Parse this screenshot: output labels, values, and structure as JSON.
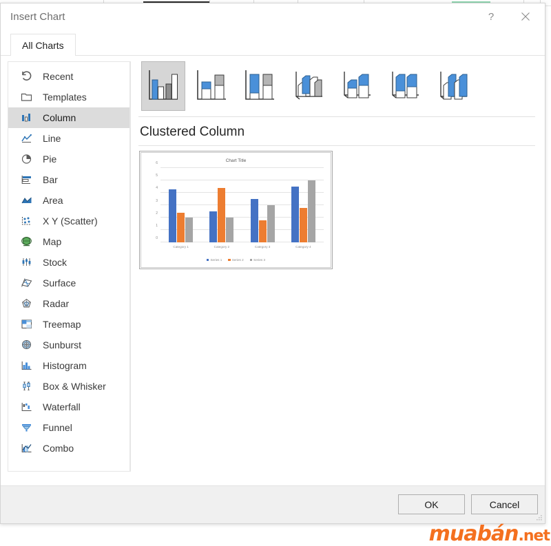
{
  "dialog": {
    "title": "Insert Chart",
    "help_label": "?",
    "close_label": "×"
  },
  "tabs": [
    {
      "label": "All Charts",
      "name": "tab-all-charts",
      "active": true
    }
  ],
  "sidebar": {
    "items": [
      {
        "label": "Recent",
        "icon": "recent-icon",
        "selected": false
      },
      {
        "label": "Templates",
        "icon": "templates-icon",
        "selected": false
      },
      {
        "label": "Column",
        "icon": "column-chart-icon",
        "selected": true
      },
      {
        "label": "Line",
        "icon": "line-chart-icon",
        "selected": false
      },
      {
        "label": "Pie",
        "icon": "pie-chart-icon",
        "selected": false
      },
      {
        "label": "Bar",
        "icon": "bar-chart-icon",
        "selected": false
      },
      {
        "label": "Area",
        "icon": "area-chart-icon",
        "selected": false
      },
      {
        "label": "X Y (Scatter)",
        "icon": "scatter-chart-icon",
        "selected": false
      },
      {
        "label": "Map",
        "icon": "map-chart-icon",
        "selected": false
      },
      {
        "label": "Stock",
        "icon": "stock-chart-icon",
        "selected": false
      },
      {
        "label": "Surface",
        "icon": "surface-chart-icon",
        "selected": false
      },
      {
        "label": "Radar",
        "icon": "radar-chart-icon",
        "selected": false
      },
      {
        "label": "Treemap",
        "icon": "treemap-chart-icon",
        "selected": false
      },
      {
        "label": "Sunburst",
        "icon": "sunburst-chart-icon",
        "selected": false
      },
      {
        "label": "Histogram",
        "icon": "histogram-chart-icon",
        "selected": false
      },
      {
        "label": "Box & Whisker",
        "icon": "box-whisker-icon",
        "selected": false
      },
      {
        "label": "Waterfall",
        "icon": "waterfall-chart-icon",
        "selected": false
      },
      {
        "label": "Funnel",
        "icon": "funnel-chart-icon",
        "selected": false
      },
      {
        "label": "Combo",
        "icon": "combo-chart-icon",
        "selected": false
      }
    ]
  },
  "gallery": {
    "items": [
      {
        "name": "clustered-column",
        "selected": true
      },
      {
        "name": "stacked-column",
        "selected": false
      },
      {
        "name": "100-percent-stacked-column",
        "selected": false
      },
      {
        "name": "3d-clustered-column",
        "selected": false
      },
      {
        "name": "3d-stacked-column",
        "selected": false
      },
      {
        "name": "3d-100-percent-stacked-column",
        "selected": false
      },
      {
        "name": "3d-column",
        "selected": false
      }
    ]
  },
  "preview": {
    "type_title": "Clustered Column"
  },
  "chart_data": {
    "type": "bar",
    "title": "Chart Title",
    "xlabel": "",
    "ylabel": "",
    "ylim": [
      0,
      6
    ],
    "yticks": [
      0,
      1,
      2,
      3,
      4,
      5,
      6
    ],
    "grid": true,
    "legend_position": "bottom",
    "categories": [
      "Category 1",
      "Category 2",
      "Category 3",
      "Category 4"
    ],
    "series": [
      {
        "name": "Series 1",
        "color": "#4472C4",
        "values": [
          4.3,
          2.5,
          3.5,
          4.5
        ]
      },
      {
        "name": "Series 2",
        "color": "#ED7D31",
        "values": [
          2.4,
          4.4,
          1.8,
          2.8
        ]
      },
      {
        "name": "Series 3",
        "color": "#A5A5A5",
        "values": [
          2.0,
          2.0,
          3.0,
          5.0
        ]
      }
    ]
  },
  "footer": {
    "ok_label": "OK",
    "cancel_label": "Cancel"
  },
  "watermark": {
    "brand": "muabán",
    "tld": ".net"
  }
}
